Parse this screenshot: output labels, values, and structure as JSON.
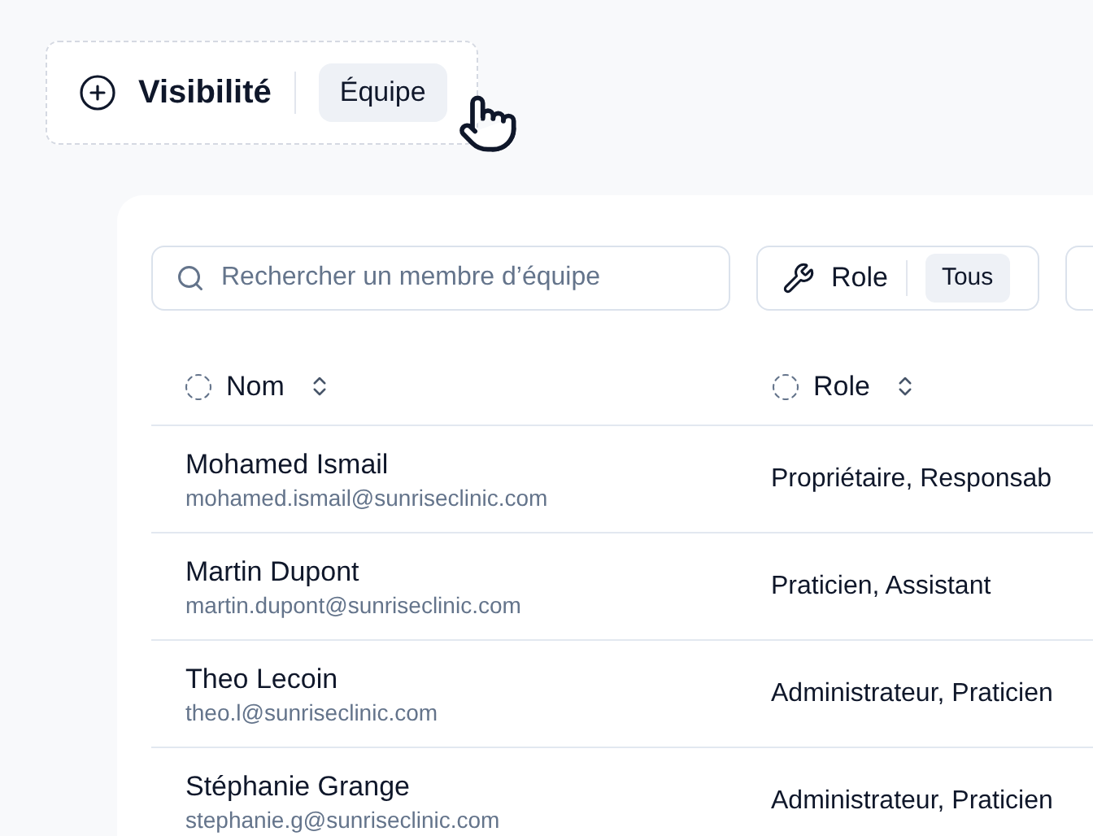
{
  "visibility_chip": {
    "label": "Visibilité",
    "value": "Équipe"
  },
  "toolbar": {
    "search": {
      "placeholder": "Rechercher un membre d’équipe"
    },
    "role_filter": {
      "label": "Role",
      "value": "Tous"
    }
  },
  "table": {
    "columns": [
      {
        "label": "Nom"
      },
      {
        "label": "Role"
      }
    ],
    "rows": [
      {
        "name": "Mohamed Ismail",
        "email": "mohamed.ismail@sunriseclinic.com",
        "role": "Propriétaire, Responsab"
      },
      {
        "name": "Martin Dupont",
        "email": "martin.dupont@sunriseclinic.com",
        "role": "Praticien, Assistant"
      },
      {
        "name": "Theo Lecoin",
        "email": "theo.l@sunriseclinic.com",
        "role": "Administrateur, Praticien"
      },
      {
        "name": "Stéphanie Grange",
        "email": "stephanie.g@sunriseclinic.com",
        "role": "Administrateur, Praticien"
      }
    ]
  }
}
